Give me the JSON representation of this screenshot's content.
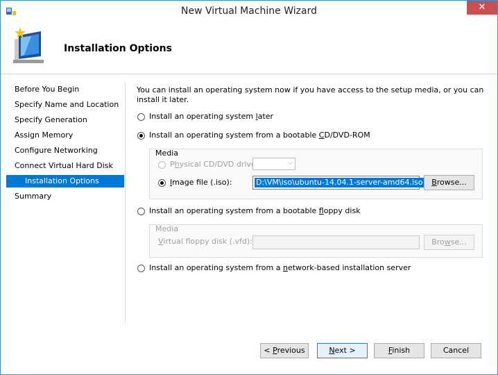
{
  "window": {
    "title": "New Virtual Machine Wizard",
    "close_glyph": "✕"
  },
  "header": {
    "title": "Installation Options",
    "icon": "wizard-computer-icon"
  },
  "sidebar": {
    "items": [
      {
        "label": "Before You Begin"
      },
      {
        "label": "Specify Name and Location"
      },
      {
        "label": "Specify Generation"
      },
      {
        "label": "Assign Memory"
      },
      {
        "label": "Configure Networking"
      },
      {
        "label": "Connect Virtual Hard Disk"
      },
      {
        "label": "Installation Options",
        "active": true
      },
      {
        "label": "Summary"
      }
    ]
  },
  "content": {
    "intro": "You can install an operating system now if you have access to the setup media, or you can install it later.",
    "options": {
      "later": {
        "pre": "Install an operating system ",
        "u": "l",
        "post": "ater",
        "checked": false
      },
      "cd": {
        "pre": "Install an operating system from a bootable ",
        "u": "C",
        "post": "D/DVD-ROM",
        "checked": true
      },
      "floppy": {
        "pre": "Install an operating system from a bootable ",
        "u": "f",
        "post": "loppy disk",
        "checked": false
      },
      "network": {
        "pre": "Install an operating system from a ",
        "u": "n",
        "post": "etwork-based installation server",
        "checked": false
      }
    },
    "cd_media": {
      "title": "Media",
      "physical": {
        "pre": "P",
        "u": "h",
        "post": "ysical CD/DVD drive:",
        "checked": false
      },
      "image": {
        "pre": "",
        "u": "I",
        "post": "mage file (.iso):",
        "checked": true
      },
      "image_value": "D:\\VM\\iso\\ubuntu-14.04.1-server-amd64.iso",
      "browse": {
        "pre": "",
        "u": "B",
        "post": "rowse..."
      }
    },
    "floppy_media": {
      "title": "Media",
      "label": {
        "pre": "",
        "u": "V",
        "post": "irtual floppy disk (.vfd):"
      },
      "value": "",
      "browse": {
        "pre": "Bro",
        "u": "w",
        "post": "se..."
      }
    }
  },
  "footer": {
    "previous": {
      "pre": "< ",
      "u": "P",
      "post": "revious"
    },
    "next": {
      "pre": "",
      "u": "N",
      "post": "ext >"
    },
    "finish": {
      "pre": "",
      "u": "F",
      "post": "inish"
    },
    "cancel": "Cancel"
  },
  "colors": {
    "accent": "#0078d7",
    "close": "#c75050",
    "border": "#3a8fd1"
  }
}
